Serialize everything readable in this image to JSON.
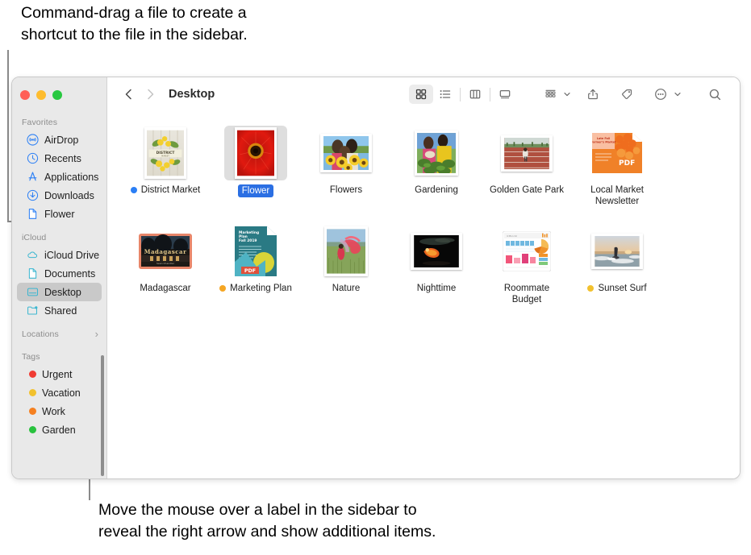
{
  "callouts": {
    "top": "Command-drag a file to create a\nshortcut to the file in the sidebar.",
    "bottom": "Move the mouse over a label in the sidebar to\nreveal the right arrow and show additional items."
  },
  "window": {
    "traffic_lights": [
      {
        "name": "close",
        "color": "#ff5f57"
      },
      {
        "name": "minimize",
        "color": "#febc2e"
      },
      {
        "name": "zoom",
        "color": "#28c840"
      }
    ]
  },
  "toolbar": {
    "back_label": "Back",
    "forward_label": "Forward",
    "path_title": "Desktop",
    "buttons": [
      {
        "name": "icon-view",
        "label": "Icon View",
        "active": true
      },
      {
        "name": "list-view",
        "label": "List View",
        "active": false
      },
      {
        "name": "column-view",
        "label": "Column View",
        "active": false
      },
      {
        "name": "gallery-view",
        "label": "Gallery View",
        "active": false
      },
      {
        "name": "group-by",
        "label": "Group",
        "active": false
      },
      {
        "name": "share",
        "label": "Share",
        "active": false
      },
      {
        "name": "tag",
        "label": "Tags",
        "active": false
      },
      {
        "name": "action-menu",
        "label": "Action",
        "active": false
      },
      {
        "name": "search",
        "label": "Search",
        "active": false
      }
    ]
  },
  "sidebar": {
    "sections": [
      {
        "title": "Favorites",
        "has_chevron": false,
        "items": [
          {
            "label": "AirDrop",
            "icon": "airdrop-icon",
            "color": "#2b7ff5",
            "selected": false
          },
          {
            "label": "Recents",
            "icon": "clock-icon",
            "color": "#2b7ff5",
            "selected": false
          },
          {
            "label": "Applications",
            "icon": "applications-icon",
            "color": "#2b7ff5",
            "selected": false
          },
          {
            "label": "Downloads",
            "icon": "download-icon",
            "color": "#2b7ff5",
            "selected": false
          },
          {
            "label": "Flower",
            "icon": "document-icon",
            "color": "#2b7ff5",
            "selected": false
          }
        ]
      },
      {
        "title": "iCloud",
        "has_chevron": false,
        "items": [
          {
            "label": "iCloud Drive",
            "icon": "cloud-icon",
            "color": "#3bb6d0",
            "selected": false
          },
          {
            "label": "Documents",
            "icon": "document-icon",
            "color": "#3bb6d0",
            "selected": false
          },
          {
            "label": "Desktop",
            "icon": "desktop-icon",
            "color": "#3bb6d0",
            "selected": true
          },
          {
            "label": "Shared",
            "icon": "shared-folder-icon",
            "color": "#3bb6d0",
            "selected": false
          }
        ]
      },
      {
        "title": "Locations",
        "has_chevron": true,
        "chevron": "›",
        "items": []
      },
      {
        "title": "Tags",
        "has_chevron": false,
        "items": [
          {
            "label": "Urgent",
            "icon": "tag-dot",
            "color": "#f03b33",
            "selected": false
          },
          {
            "label": "Vacation",
            "icon": "tag-dot",
            "color": "#f2c12e",
            "selected": false
          },
          {
            "label": "Work",
            "icon": "tag-dot",
            "color": "#f58020",
            "selected": false
          },
          {
            "label": "Garden",
            "icon": "tag-dot",
            "color": "#29c23e",
            "selected": false
          }
        ]
      }
    ]
  },
  "files": [
    {
      "name": "District Market",
      "kind": "image",
      "tag_color": "#2b7ff5",
      "selected": false
    },
    {
      "name": "Flower",
      "kind": "image",
      "tag_color": null,
      "selected": true
    },
    {
      "name": "Flowers",
      "kind": "image",
      "tag_color": null,
      "selected": false
    },
    {
      "name": "Gardening",
      "kind": "image",
      "tag_color": null,
      "selected": false
    },
    {
      "name": "Golden Gate Park",
      "kind": "image",
      "tag_color": null,
      "selected": false
    },
    {
      "name": "Local Market\nNewsletter",
      "kind": "pdf",
      "tag_color": null,
      "selected": false
    },
    {
      "name": "Madagascar",
      "kind": "keynote",
      "tag_color": null,
      "selected": false
    },
    {
      "name": "Marketing Plan",
      "kind": "pdf",
      "tag_color": "#f5a623",
      "selected": false
    },
    {
      "name": "Nature",
      "kind": "image",
      "tag_color": null,
      "selected": false
    },
    {
      "name": "Nighttime",
      "kind": "image",
      "tag_color": null,
      "selected": false
    },
    {
      "name": "Roommate\nBudget",
      "kind": "numbers",
      "tag_color": null,
      "selected": false
    },
    {
      "name": "Sunset Surf",
      "kind": "image",
      "tag_color": "#f2c12e",
      "selected": false
    }
  ]
}
